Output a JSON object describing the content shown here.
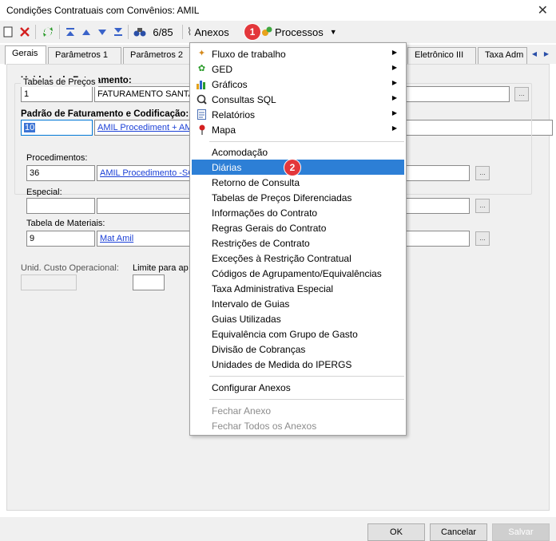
{
  "window": {
    "title": "Condições Contratuais com Convênios: AMIL",
    "close": "✕"
  },
  "toolbar": {
    "record_counter": "6/85",
    "anexos_label": "Anexos",
    "processos_label": "Processos",
    "badge1": "1"
  },
  "tabs": [
    {
      "label": "Gerais"
    },
    {
      "label": "Parâmetros 1"
    },
    {
      "label": "Parâmetros 2"
    },
    {
      "label": "Eletrônico III"
    },
    {
      "label": "Taxa Adm"
    }
  ],
  "form": {
    "unidade_label": "Unidade de Faturamento:",
    "unidade_code": "1",
    "unidade_name": "FATURAMENTO SANTA C",
    "padrao_label": "Padrão de Faturamento e Codificação:",
    "padrao_code": "10",
    "padrao_name": "AMIL Procediment + AMIL",
    "tabelas_title": "Tabelas de Preços",
    "procedimentos_label": "Procedimentos:",
    "proc_code": "36",
    "proc_name": "AMIL Procedimento -SCC",
    "especial_label": "Especial:",
    "materiais_label": "Tabela de Materiais:",
    "mat_code": "9",
    "mat_name": "Mat Amil",
    "unid_custo_label": "Unid. Custo Operacional:",
    "limite_label": "Limite para ap"
  },
  "menu": {
    "group1": [
      {
        "label": "Fluxo de trabalho",
        "icon": "workflow-icon"
      },
      {
        "label": "GED",
        "icon": "ged-icon"
      },
      {
        "label": "Gráficos",
        "icon": "chart-icon"
      },
      {
        "label": "Consultas SQL",
        "icon": "sql-query-icon"
      },
      {
        "label": "Relatórios",
        "icon": "report-icon"
      },
      {
        "label": "Mapa",
        "icon": "map-pin-icon"
      }
    ],
    "group2": [
      "Acomodação",
      "Diárias",
      "Retorno de Consulta",
      "Tabelas de Preços Diferenciadas",
      "Informações do Contrato",
      "Regras Gerais do Contrato",
      "Restrições de Contrato",
      "Exceções à Restrição Contratual",
      "Códigos de Agrupamento/Equivalências",
      "Taxa Administrativa Especial",
      "Intervalo de Guias",
      "Guias Utilizadas",
      "Equivalência com Grupo de Gasto",
      "Divisão de Cobranças",
      "Unidades de Medida do IPERGS"
    ],
    "configurar": "Configurar Anexos",
    "fechar": "Fechar Anexo",
    "fechar_todos": "Fechar Todos os Anexos",
    "badge2": "2"
  },
  "footer": {
    "ok": "OK",
    "cancelar": "Cancelar",
    "salvar": "Salvar"
  }
}
